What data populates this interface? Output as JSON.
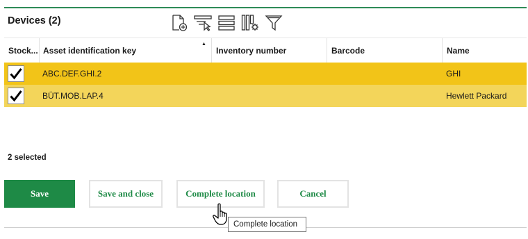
{
  "header": {
    "title": "Devices (2)"
  },
  "toolbar": {
    "icons": [
      "add-document-icon",
      "column-select-icon",
      "rows-icon",
      "column-settings-icon",
      "filter-icon"
    ]
  },
  "table": {
    "columns": [
      "Stock...",
      "Asset identification key",
      "Inventory number",
      "Barcode",
      "Name"
    ],
    "sort_column": "Asset identification key",
    "sort_direction": "ascending",
    "rows": [
      {
        "checked": true,
        "asset_key": "ABC.DEF.GHI.2",
        "inventory_number": "",
        "barcode": "",
        "name": "GHI",
        "color": "#f2c418"
      },
      {
        "checked": true,
        "asset_key": "BÜT.MOB.LAP.4",
        "inventory_number": "",
        "barcode": "",
        "name": "Hewlett Packard",
        "color": "#f3d55a"
      }
    ]
  },
  "status": {
    "selected_text": "2 selected"
  },
  "buttons": {
    "save": "Save",
    "save_and_close": "Save and close",
    "complete_location": "Complete location",
    "cancel": "Cancel"
  },
  "tooltip": {
    "text": "Complete location"
  },
  "colors": {
    "accent": "#1e8a46",
    "row_selected": "#f2c418",
    "row_selected_alt": "#f3d55a"
  }
}
